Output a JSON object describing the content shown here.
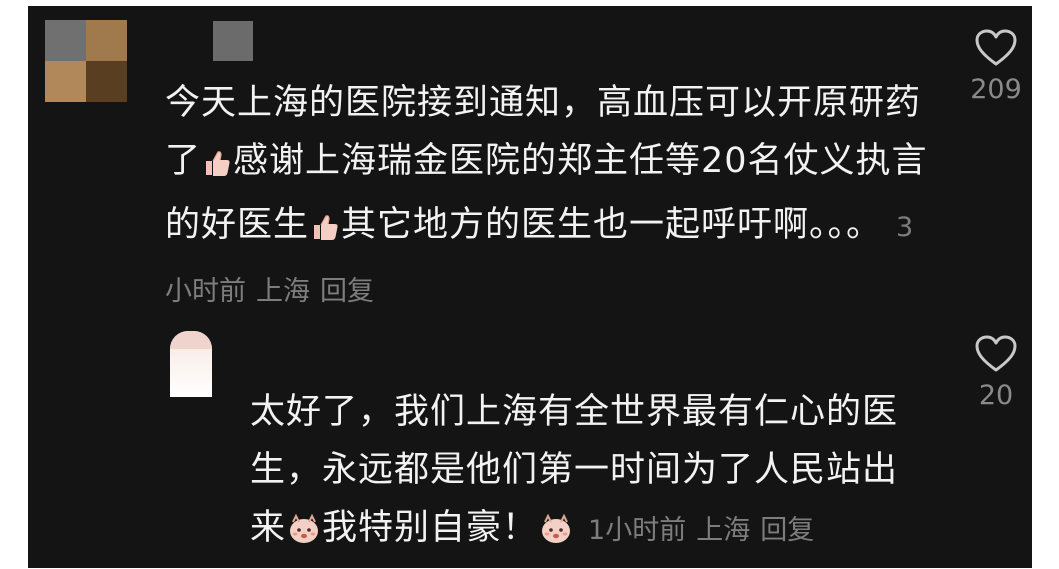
{
  "comments": [
    {
      "text": "今天上海的医院接到通知，高血压可以开原研药了",
      "text_b": "感谢上海瑞金医院的郑主任等20名仗义执言的好医生",
      "text_c": "其它地方的医生也一起呼吁啊。。。",
      "emoji_icon": "thumbs-up-emoji",
      "time": "3小时前",
      "location": "上海",
      "reply_label": "回复",
      "likes": "209"
    },
    {
      "text": "太好了，我们上海有全世界最有仁心的医生，永远都是他们第一时间为了人民站出来",
      "text_b": "我特别自豪！",
      "emoji_icon": "proud-face-emoji",
      "time": "1小时前",
      "location": "上海",
      "reply_label": "回复",
      "likes": "20"
    }
  ],
  "colors": {
    "background": "#141414",
    "text": "#f2f2f2",
    "meta": "#7d7d7d",
    "like_count": "#8a8a8a"
  }
}
